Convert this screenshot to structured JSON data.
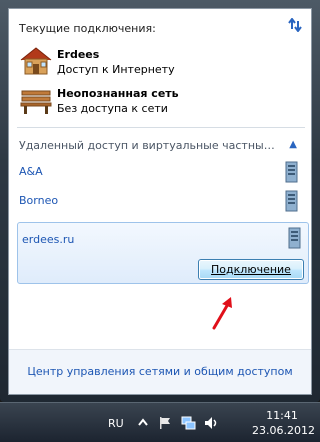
{
  "header": {
    "title": "Текущие подключения:"
  },
  "connections": [
    {
      "name": "Erdees",
      "status": "Доступ к Интернету",
      "icon": "house-network-icon"
    },
    {
      "name": "Неопознанная сеть",
      "status": "Без доступа к сети",
      "icon": "bench-network-icon"
    }
  ],
  "vpn": {
    "header": "Удаленный доступ и виртуальные частные се...",
    "items": [
      {
        "label": "A&A"
      },
      {
        "label": "Borneo"
      }
    ],
    "selected": {
      "label": "erdees.ru",
      "button": "Подключение"
    }
  },
  "footer": {
    "link": "Центр управления сетями и общим доступом"
  },
  "taskbar": {
    "language": "RU",
    "time": "11:41",
    "date": "23.06.2012"
  },
  "colors": {
    "link": "#1d56b3",
    "accent": "#2a65c0",
    "arrow": "#e0101a"
  }
}
